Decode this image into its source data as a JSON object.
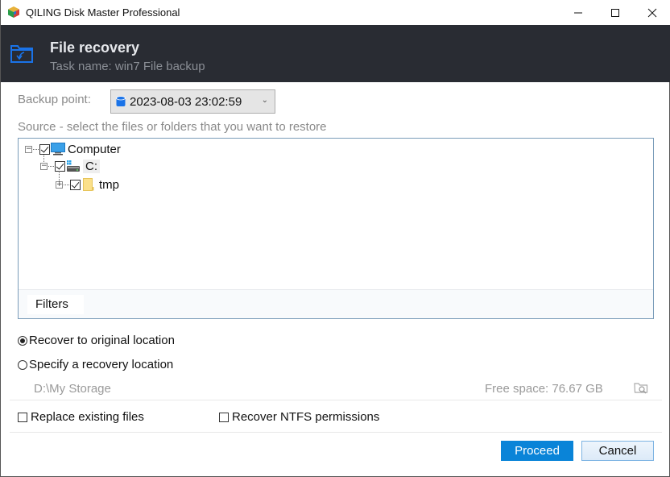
{
  "window": {
    "title": "QILING Disk Master Professional",
    "controls": {
      "minimize": "—",
      "maximize": "☐",
      "close": "✕"
    }
  },
  "header": {
    "icon": "folder-recover-icon",
    "title": "File recovery",
    "subtitle": "Task name: win7 File backup"
  },
  "backup_point": {
    "label": "Backup point:",
    "selected": "2023-08-03 23:02:59",
    "icon": "database-icon"
  },
  "source": {
    "label": "Source - select the files or folders that you want to restore",
    "tree": [
      {
        "label": "Computer",
        "checked": true,
        "expanded": true,
        "icon": "computer-icon"
      },
      {
        "label": "C:",
        "checked": true,
        "expanded": true,
        "icon": "drive-icon"
      },
      {
        "label": "tmp",
        "checked": true,
        "expanded": false,
        "icon": "folder-icon"
      }
    ],
    "filters_label": "Filters"
  },
  "recovery": {
    "option_original": "Recover to original location",
    "option_specify": "Specify a recovery location",
    "selected": "original",
    "path": "D:\\My Storage",
    "free_space": "Free space: 76.67 GB"
  },
  "options": {
    "replace_existing": {
      "label": "Replace existing files",
      "checked": false
    },
    "ntfs_permissions": {
      "label": "Recover NTFS permissions",
      "checked": false
    }
  },
  "buttons": {
    "proceed": "Proceed",
    "cancel": "Cancel"
  },
  "colors": {
    "header_bg": "#292c33",
    "accent": "#0a84d8",
    "icon_blue": "#1a73e8"
  }
}
